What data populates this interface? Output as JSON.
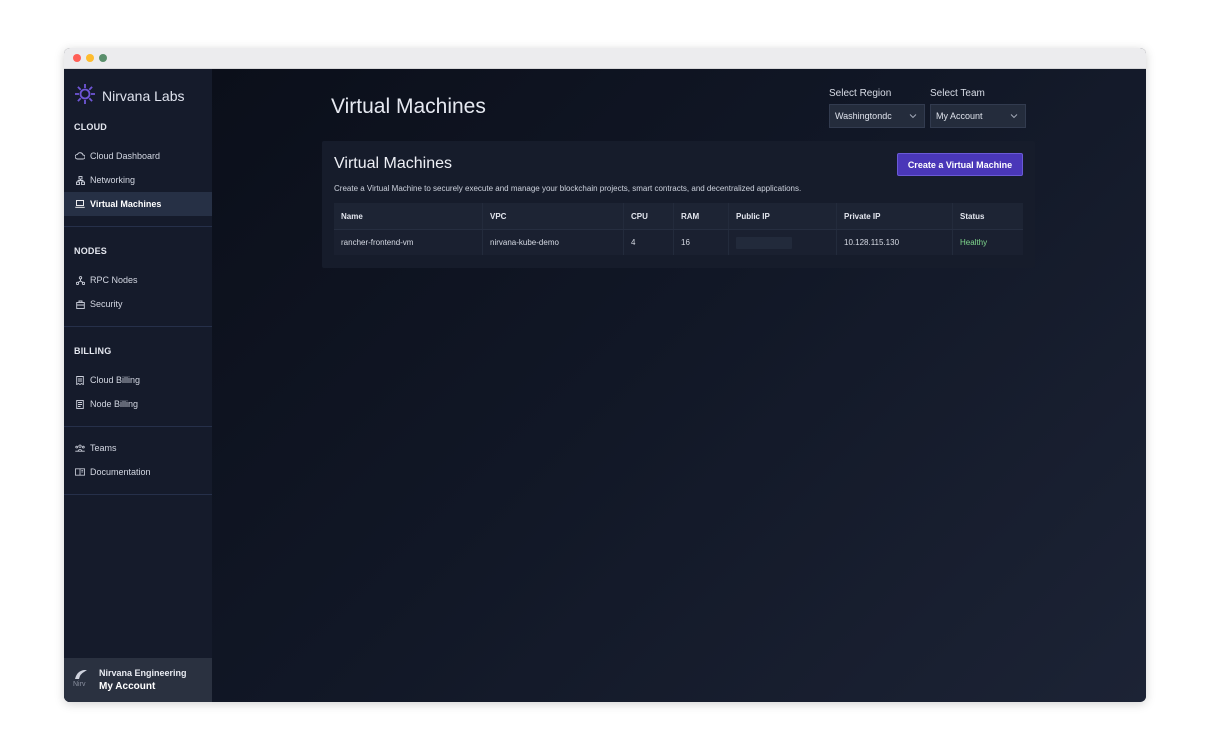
{
  "brand": {
    "name": "Nirvana Labs"
  },
  "sidebar": {
    "sections": [
      {
        "title": "CLOUD",
        "items": [
          {
            "label": "Cloud Dashboard",
            "icon": "cloud-icon",
            "active": false
          },
          {
            "label": "Networking",
            "icon": "network-icon",
            "active": false
          },
          {
            "label": "Virtual Machines",
            "icon": "laptop-icon",
            "active": true
          }
        ]
      },
      {
        "title": "NODES",
        "items": [
          {
            "label": "RPC Nodes",
            "icon": "nodes-icon",
            "active": false
          },
          {
            "label": "Security",
            "icon": "security-icon",
            "active": false
          }
        ]
      },
      {
        "title": "BILLING",
        "items": [
          {
            "label": "Cloud Billing",
            "icon": "receipt-icon",
            "active": false
          },
          {
            "label": "Node Billing",
            "icon": "invoice-icon",
            "active": false
          }
        ]
      },
      {
        "title": "",
        "items": [
          {
            "label": "Teams",
            "icon": "teams-icon",
            "active": false
          },
          {
            "label": "Documentation",
            "icon": "book-icon",
            "active": false
          }
        ]
      }
    ],
    "account": {
      "avatar_text": "Nirv",
      "name": "Nirvana Engineering",
      "subtitle": "My Account"
    }
  },
  "header": {
    "title": "Virtual Machines",
    "region": {
      "label": "Select Region",
      "value": "Washingtondc"
    },
    "team": {
      "label": "Select Team",
      "value": "My Account"
    }
  },
  "card": {
    "title": "Virtual Machines",
    "description": "Create a Virtual Machine to securely execute and manage your blockchain projects, smart contracts, and decentralized applications.",
    "create_button": "Create a Virtual Machine",
    "table": {
      "columns": [
        "Name",
        "VPC",
        "CPU",
        "RAM",
        "Public IP",
        "Private IP",
        "Status"
      ],
      "rows": [
        {
          "name": "rancher-frontend-vm",
          "vpc": "nirvana-kube-demo",
          "cpu": "4",
          "ram": "16",
          "public_ip": "",
          "private_ip": "10.128.115.130",
          "status": "Healthy"
        }
      ]
    }
  },
  "colors": {
    "accent": "#4a37b8",
    "healthy": "#7fd88d",
    "sidebar_bg": "#151b2b"
  }
}
